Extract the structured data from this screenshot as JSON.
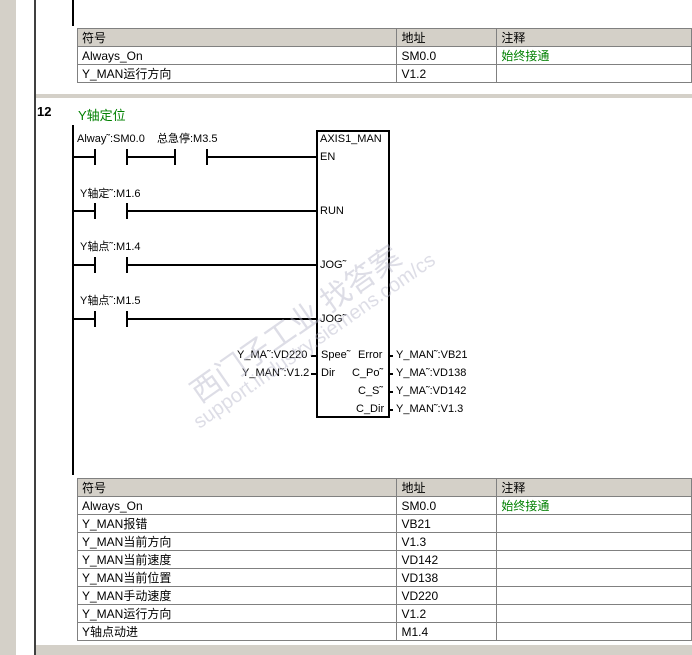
{
  "table1": {
    "headers": [
      "符号",
      "地址",
      "注释"
    ],
    "rows": [
      [
        "Always_On",
        "SM0.0",
        "始终接通"
      ],
      [
        "Y_MAN运行方向",
        "V1.2",
        ""
      ]
    ]
  },
  "network": {
    "number": "12",
    "title": "Y轴定位"
  },
  "contacts": {
    "c1": "Alway˜:SM0.0",
    "c2": "总急停:M3.5",
    "c3": "Y轴定˜:M1.6",
    "c4": "Y轴点˜:M1.4",
    "c5": "Y轴点˜:M1.5"
  },
  "block": {
    "title": "AXIS1_MAN",
    "pins_in": [
      "EN",
      "RUN",
      "JOG˜",
      "JOG˜",
      "Spee˜",
      "Dir"
    ],
    "pins_out": [
      "Error",
      "C_Po˜",
      "C_S˜",
      "C_Dir"
    ],
    "in_operands": [
      "Y_MA˜:VD220",
      "Y_MAN˜:V1.2"
    ],
    "out_operands": [
      "Y_MAN˜:VB21",
      "Y_MA˜:VD138",
      "Y_MA˜:VD142",
      "Y_MAN˜:V1.3"
    ]
  },
  "table2": {
    "headers": [
      "符号",
      "地址",
      "注释"
    ],
    "rows": [
      [
        "Always_On",
        "SM0.0",
        "始终接通"
      ],
      [
        "Y_MAN报错",
        "VB21",
        ""
      ],
      [
        "Y_MAN当前方向",
        "V1.3",
        ""
      ],
      [
        "Y_MAN当前速度",
        "VD142",
        ""
      ],
      [
        "Y_MAN当前位置",
        "VD138",
        ""
      ],
      [
        "Y_MAN手动速度",
        "VD220",
        ""
      ],
      [
        "Y_MAN运行方向",
        "V1.2",
        ""
      ],
      [
        "Y轴点动进",
        "M1.4",
        ""
      ]
    ]
  },
  "watermark": {
    "line1": "西门子工业  找答案",
    "line2": "support.industry.siemens.com/cs"
  }
}
